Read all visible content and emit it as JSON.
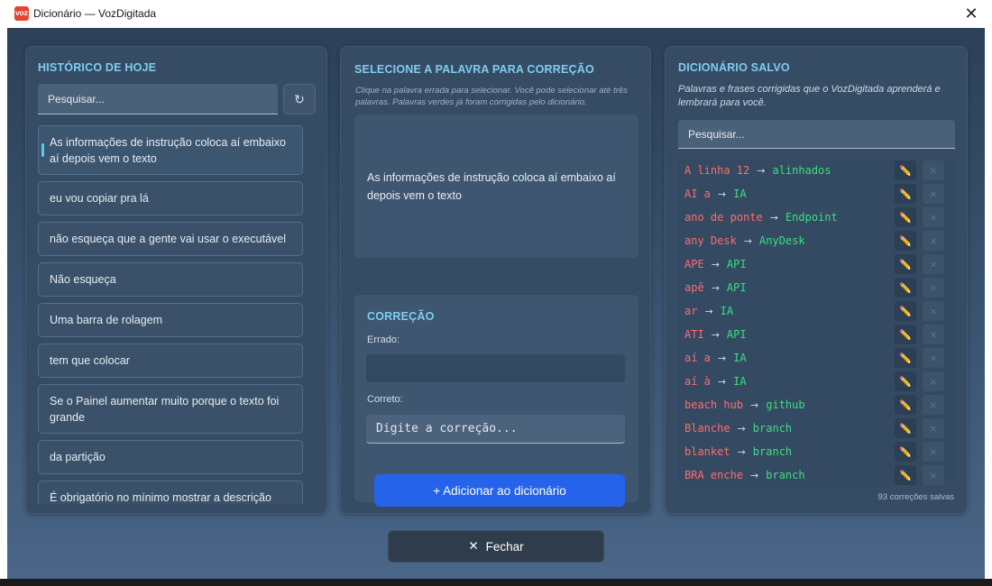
{
  "window": {
    "app_logo_text": "VOZ",
    "title": "Dicionário — VozDigitada",
    "close_glyph": "✕"
  },
  "history": {
    "title": "HISTÓRICO DE HOJE",
    "search_placeholder": "Pesquisar...",
    "refresh_glyph": "↻",
    "items": [
      "As informações de instrução coloca aí embaixo aí depois vem o texto",
      "eu vou copiar pra lá",
      "não esqueça que a gente vai usar o executável",
      "Não esqueça",
      "Uma barra de rolagem",
      "tem que colocar",
      "Se o Painel aumentar muito porque o texto foi grande",
      "da partição",
      "É obrigatório no mínimo mostrar a descrição"
    ]
  },
  "select": {
    "title": "SELECIONE A PALAVRA PARA CORREÇÃO",
    "hint": "Clique na palavra errada para selecionar. Você pode selecionar até três palavras. Palavras verdes já foram corrigidas pelo dicionário.",
    "preview_text": "As informações de instrução coloca aí embaixo aí depois vem o texto"
  },
  "correction": {
    "title": "CORREÇÃO",
    "wrong_label": "Errado:",
    "wrong_value": "",
    "correct_label": "Correto:",
    "correct_placeholder": "Digite a correção...",
    "add_button": "+ Adicionar ao dicionário"
  },
  "dictionary": {
    "title": "DICIONÁRIO SALVO",
    "hint": "Palavras e frases corrigidas que o VozDigitada aprenderá e lembrará para você.",
    "search_placeholder": "Pesquisar...",
    "arrow": "→",
    "edit_glyph": "✏️",
    "delete_glyph": "✕",
    "entries": [
      {
        "wrong": "A linha 12",
        "right": "alinhados"
      },
      {
        "wrong": "AI a",
        "right": "IA"
      },
      {
        "wrong": "ano de ponte",
        "right": "Endpoint"
      },
      {
        "wrong": "any Desk",
        "right": "AnyDesk"
      },
      {
        "wrong": "APE",
        "right": "API"
      },
      {
        "wrong": "apê",
        "right": "API"
      },
      {
        "wrong": "ar",
        "right": "IA"
      },
      {
        "wrong": "ATI",
        "right": "API"
      },
      {
        "wrong": "aí a",
        "right": "IA"
      },
      {
        "wrong": "aí à",
        "right": "IA"
      },
      {
        "wrong": "beach hub",
        "right": "github"
      },
      {
        "wrong": "Blanche",
        "right": "branch"
      },
      {
        "wrong": "blanket",
        "right": "branch"
      },
      {
        "wrong": "BRA enche",
        "right": "branch"
      }
    ],
    "count_text": "93 correções salvas"
  },
  "footer": {
    "close_button": "Fechar",
    "close_glyph": "✕"
  },
  "colors": {
    "accent": "#7fcdf0",
    "wrong": "#ff6b6b",
    "right": "#3ddc84",
    "primary_button": "#2563eb"
  }
}
